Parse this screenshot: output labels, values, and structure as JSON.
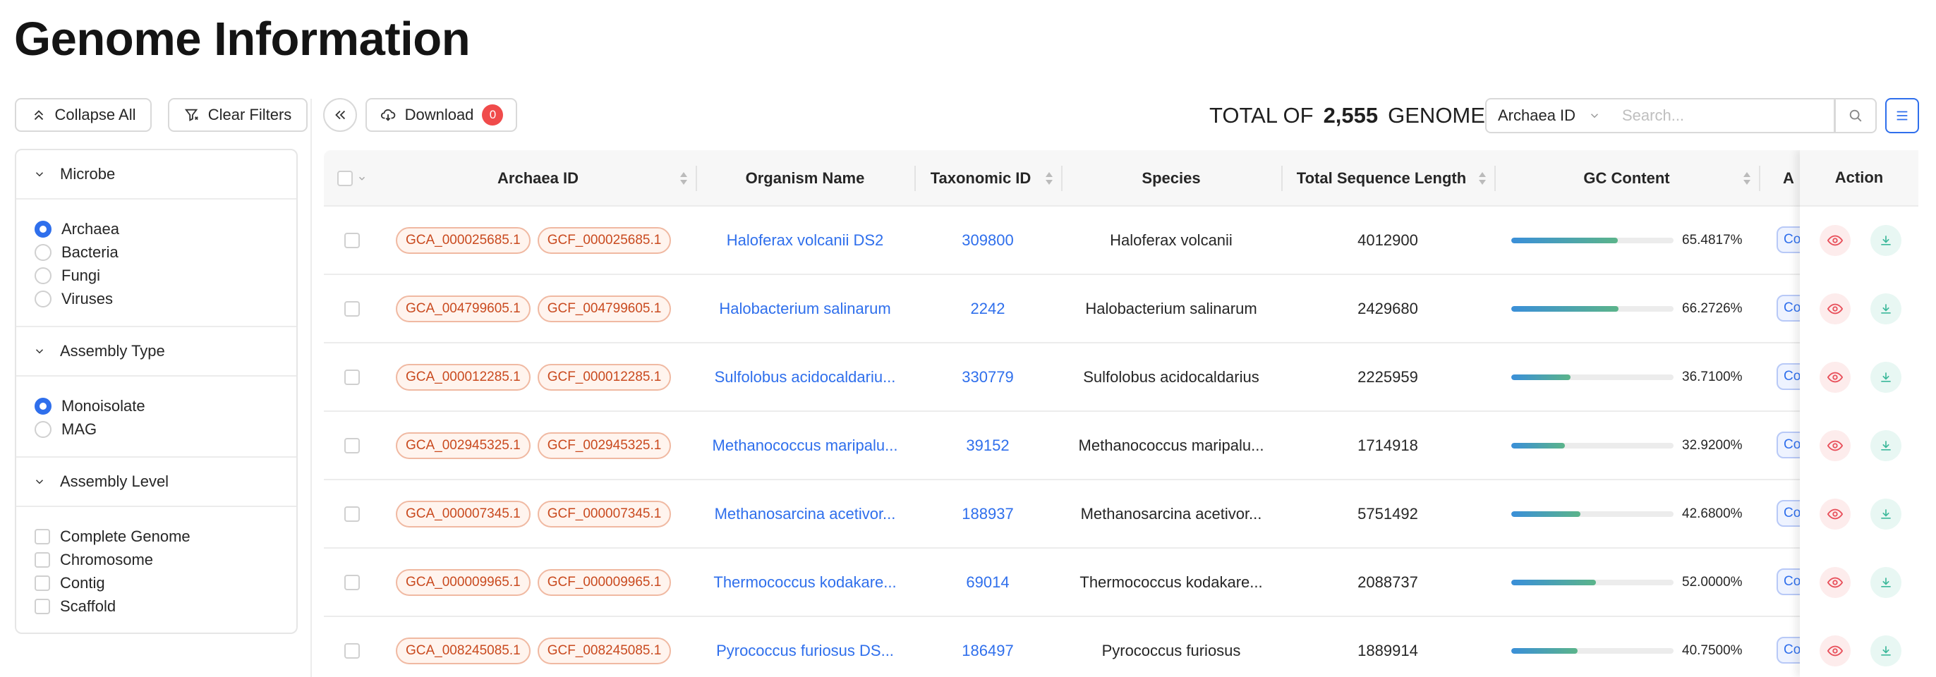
{
  "page_title": "Genome Information",
  "toolbar": {
    "collapse_all": "Collapse All",
    "clear_filters": "Clear Filters",
    "download": "Download",
    "download_count": "0",
    "total_prefix": "TOTAL OF",
    "total_count": "2,555",
    "total_suffix": "GENOME",
    "search_field": "Archaea ID",
    "search_placeholder": "Search..."
  },
  "filters": {
    "microbe": {
      "title": "Microbe",
      "options": [
        "Archaea",
        "Bacteria",
        "Fungi",
        "Viruses"
      ],
      "selected": "Archaea"
    },
    "assembly_type": {
      "title": "Assembly Type",
      "options": [
        "Monoisolate",
        "MAG"
      ],
      "selected": "Monoisolate"
    },
    "assembly_level": {
      "title": "Assembly Level",
      "options": [
        "Complete Genome",
        "Chromosome",
        "Contig",
        "Scaffold"
      ]
    }
  },
  "table": {
    "columns": {
      "archaea_id": "Archaea ID",
      "organism": "Organism Name",
      "taxid": "Taxonomic ID",
      "species": "Species",
      "length": "Total Sequence Length",
      "gc": "GC Content",
      "partial": "A",
      "action": "Action"
    },
    "partial_tag": "Co",
    "rows": [
      {
        "gca": "GCA_000025685.1",
        "gcf": "GCF_000025685.1",
        "organism": "Haloferax volcanii DS2",
        "taxid": "309800",
        "species": "Haloferax volcanii",
        "length": "4012900",
        "gc_value": 65.4817,
        "gc": "65.4817%"
      },
      {
        "gca": "GCA_004799605.1",
        "gcf": "GCF_004799605.1",
        "organism": "Halobacterium salinarum",
        "taxid": "2242",
        "species": "Halobacterium salinarum",
        "length": "2429680",
        "gc_value": 66.2726,
        "gc": "66.2726%"
      },
      {
        "gca": "GCA_000012285.1",
        "gcf": "GCF_000012285.1",
        "organism": "Sulfolobus acidocaldariu...",
        "taxid": "330779",
        "species": "Sulfolobus acidocaldarius",
        "length": "2225959",
        "gc_value": 36.71,
        "gc": "36.7100%"
      },
      {
        "gca": "GCA_002945325.1",
        "gcf": "GCF_002945325.1",
        "organism": "Methanococcus maripalu...",
        "taxid": "39152",
        "species": "Methanococcus maripalu...",
        "length": "1714918",
        "gc_value": 32.92,
        "gc": "32.9200%"
      },
      {
        "gca": "GCA_000007345.1",
        "gcf": "GCF_000007345.1",
        "organism": "Methanosarcina acetivor...",
        "taxid": "188937",
        "species": "Methanosarcina acetivor...",
        "length": "5751492",
        "gc_value": 42.68,
        "gc": "42.6800%"
      },
      {
        "gca": "GCA_000009965.1",
        "gcf": "GCF_000009965.1",
        "organism": "Thermococcus kodakare...",
        "taxid": "69014",
        "species": "Thermococcus kodakare...",
        "length": "2088737",
        "gc_value": 52.0,
        "gc": "52.0000%"
      },
      {
        "gca": "GCA_008245085.1",
        "gcf": "GCF_008245085.1",
        "organism": "Pyrococcus furiosus DS...",
        "taxid": "186497",
        "species": "Pyrococcus furiosus",
        "length": "1889914",
        "gc_value": 40.75,
        "gc": "40.7500%"
      }
    ]
  },
  "colors": {
    "accent": "#2f6fec",
    "tag_text": "#c94a1f",
    "tag_border": "#f0b9a2",
    "view_action": "#e8505b",
    "download_action": "#3bb89a"
  }
}
